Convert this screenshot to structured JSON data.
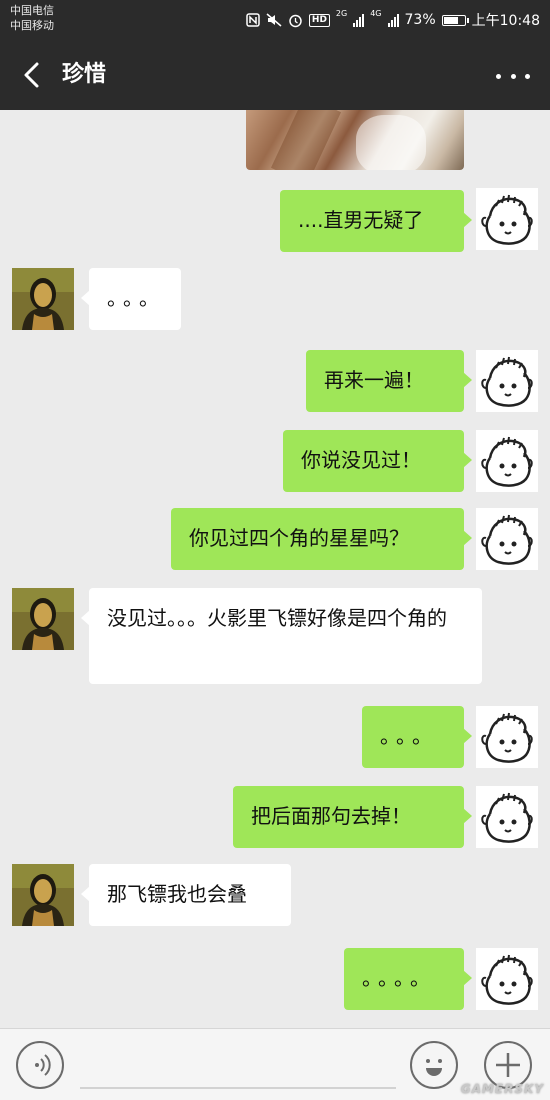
{
  "status_bar": {
    "carrier_1": "中国电信",
    "carrier_2": "中国移动",
    "network_1": "2G",
    "network_2": "4G",
    "hd": "HD",
    "battery": "73%",
    "battery_level": 0.73,
    "time": "上午10:48"
  },
  "header": {
    "title": "珍惜",
    "back_icon": "chevron-left-icon",
    "more_icon": "more-dots-icon"
  },
  "messages": [
    {
      "from": "me",
      "text": "....直男无疑了"
    },
    {
      "from": "them",
      "text": "。。。"
    },
    {
      "from": "me",
      "text": "再来一遍！"
    },
    {
      "from": "me",
      "text": "你说没见过！"
    },
    {
      "from": "me",
      "text": "你见过四个角的星星吗？"
    },
    {
      "from": "them",
      "text": "没见过。。。火影里飞镖好像是四个角的"
    },
    {
      "from": "me",
      "text": "。。。"
    },
    {
      "from": "me",
      "text": "把后面那句去掉！"
    },
    {
      "from": "them",
      "text": "那飞镖我也会叠"
    },
    {
      "from": "me",
      "text": "。。。。"
    }
  ],
  "input_bar": {
    "voice_icon": "voice-icon",
    "emoji_icon": "emoji-icon",
    "plus_icon": "plus-icon",
    "input_value": ""
  },
  "watermark": "GAMERSKY",
  "colors": {
    "header_bg": "#2b2b2b",
    "chat_bg": "#ebebeb",
    "my_bubble": "#9fe658",
    "their_bubble": "#ffffff"
  }
}
